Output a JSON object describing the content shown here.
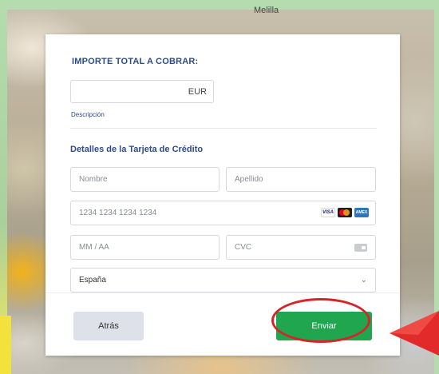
{
  "header": {
    "city": "Melilla"
  },
  "payment": {
    "total_label": "IMPORTE TOTAL A COBRAR:",
    "amount_value": "",
    "currency": "EUR",
    "description_label": "Descripción"
  },
  "card_details": {
    "title": "Detalles de la Tarjeta de Crédito",
    "first_name_placeholder": "Nombre",
    "last_name_placeholder": "Apellido",
    "card_number_placeholder": "1234 1234 1234 1234",
    "expiry_placeholder": "MM / AA",
    "cvc_placeholder": "CVC",
    "country_value": "España",
    "card_brands": [
      "VISA",
      "mastercard-icon",
      "AMEX"
    ]
  },
  "actions": {
    "back_label": "Atrás",
    "send_label": "Enviar"
  },
  "colors": {
    "accent_blue": "#2d4b8a",
    "send_green": "#1fa64e",
    "highlight_red": "#d4252a",
    "frame_green": "#b5dcae"
  }
}
